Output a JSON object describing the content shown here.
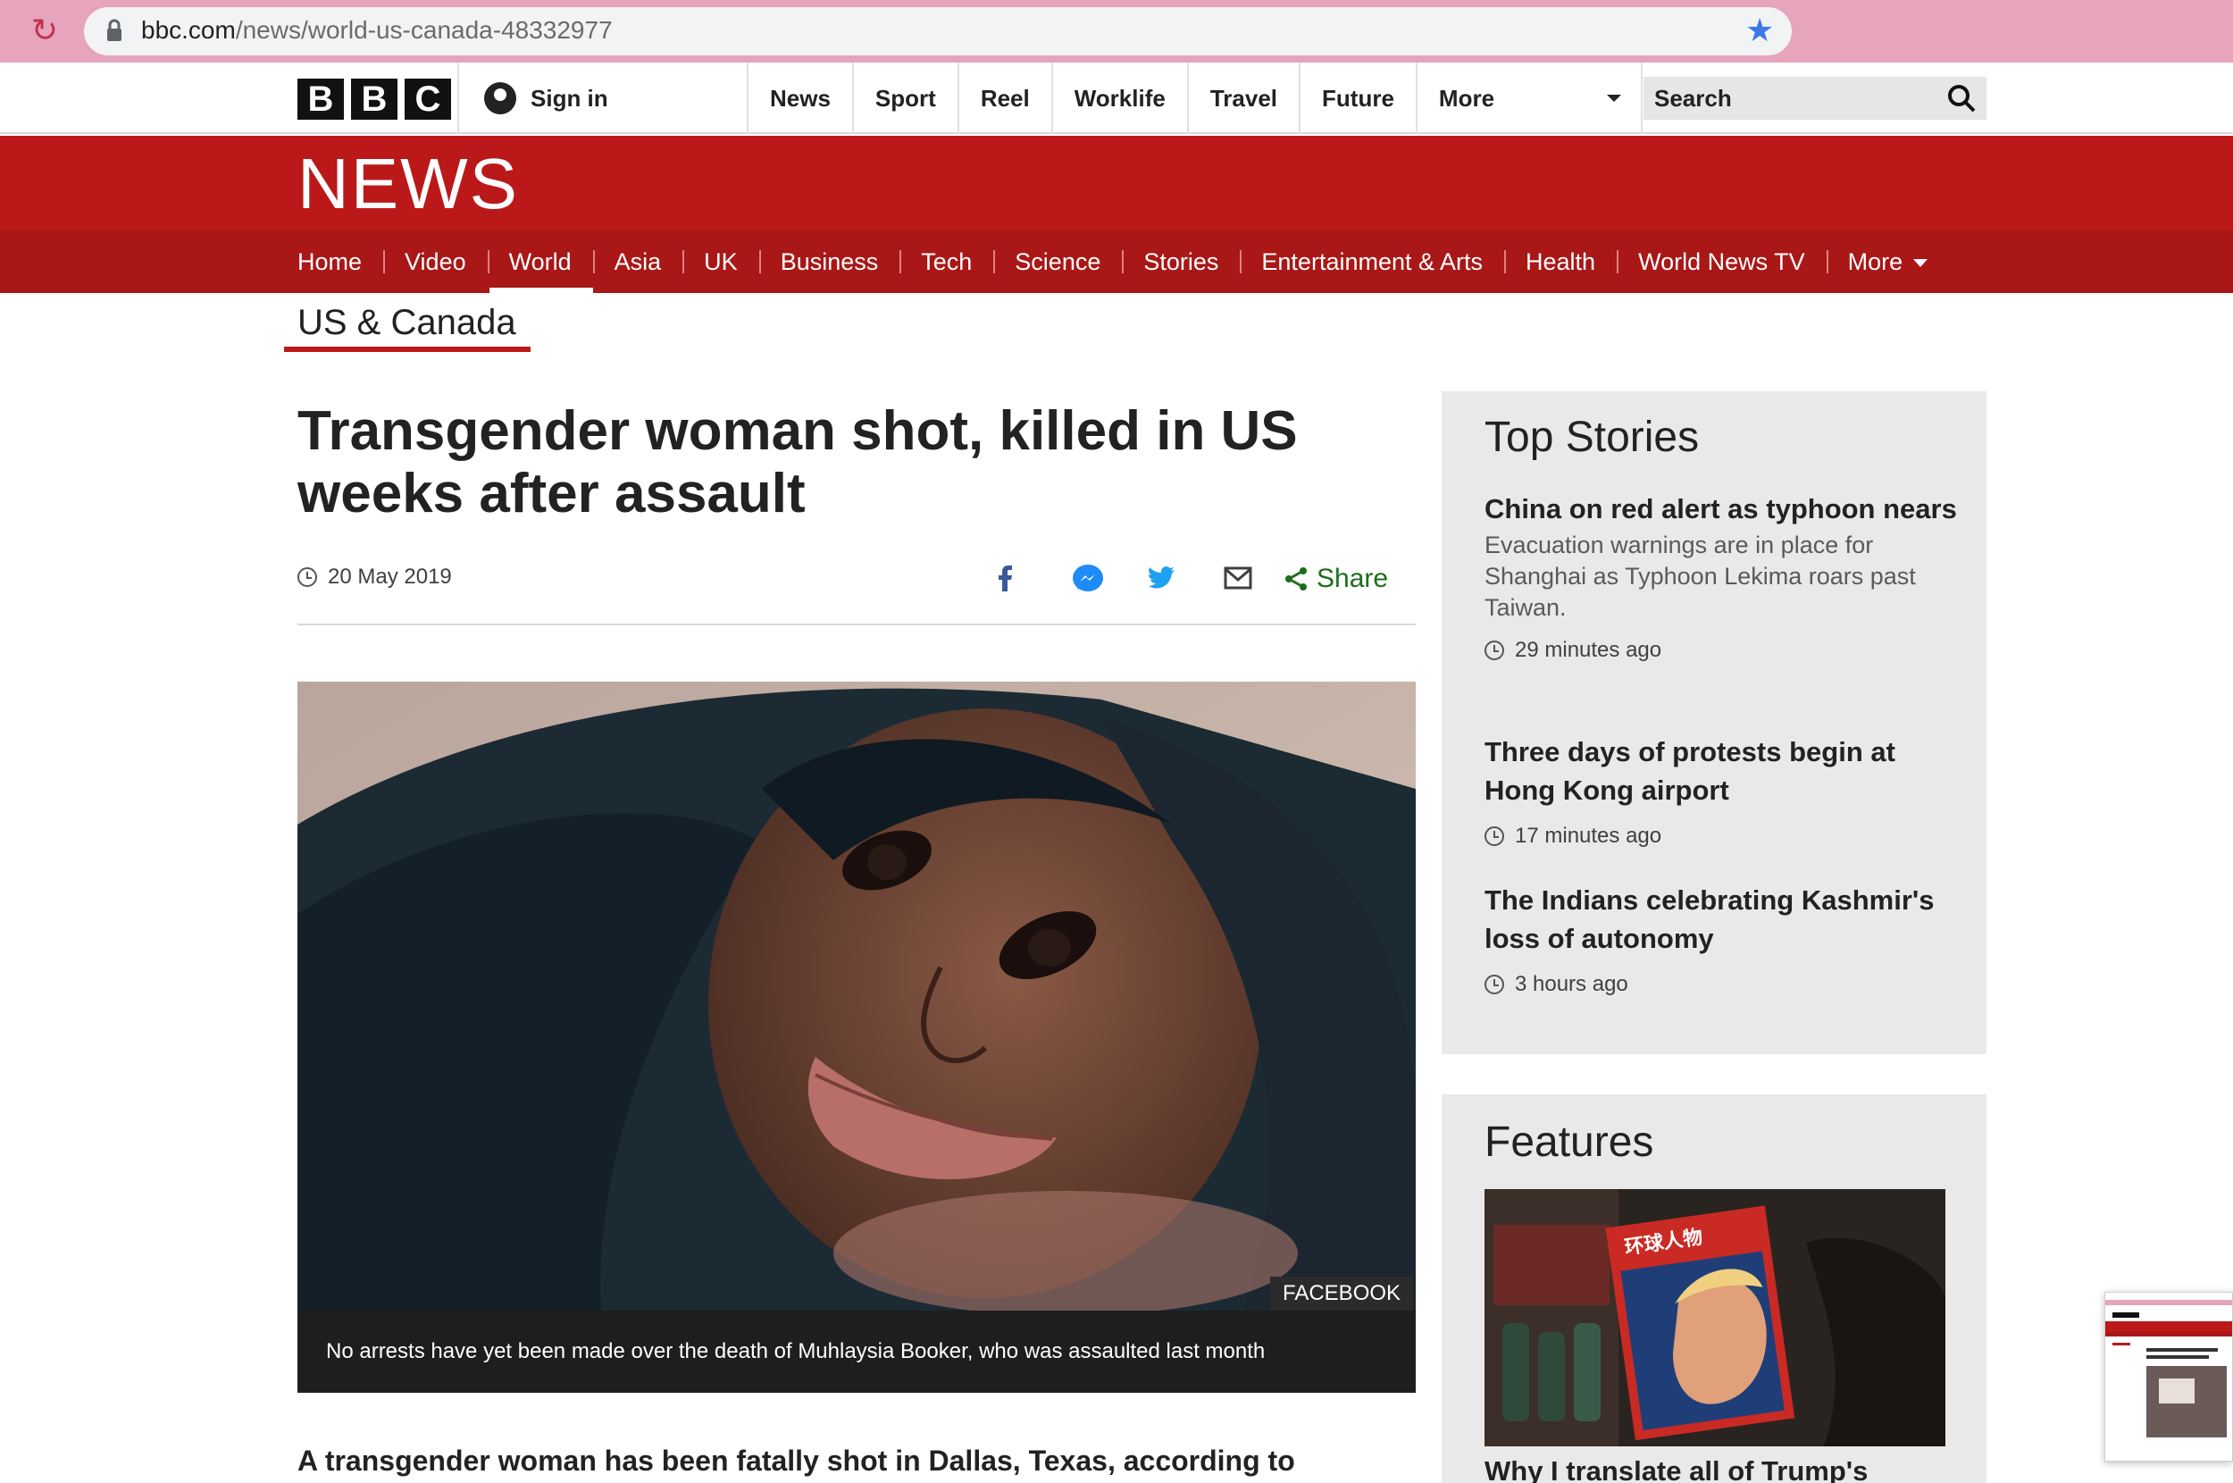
{
  "browser": {
    "url_domain": "bbc.com",
    "url_path": "/news/world-us-canada-48332977"
  },
  "masthead": {
    "logo_letters": [
      "B",
      "B",
      "C"
    ],
    "signin_label": "Sign in",
    "nav": [
      "News",
      "Sport",
      "Reel",
      "Worklife",
      "Travel",
      "Future",
      "More"
    ],
    "search_placeholder": "Search"
  },
  "news": {
    "title": "NEWS",
    "tabs": [
      "Home",
      "Video",
      "World",
      "Asia",
      "UK",
      "Business",
      "Tech",
      "Science",
      "Stories",
      "Entertainment & Arts",
      "Health",
      "World News TV",
      "More"
    ],
    "active_tab": "World",
    "section": "US & Canada"
  },
  "article": {
    "headline": "Transgender woman shot, killed in US weeks after assault",
    "date": "20 May 2019",
    "share_label": "Share",
    "share_icons": [
      "facebook-icon",
      "messenger-icon",
      "twitter-icon",
      "email-icon",
      "share-icon"
    ],
    "image_credit": "FACEBOOK",
    "caption": "No arrests have yet been made over the death of Muhlaysia Booker, who was assaulted last month",
    "lede": "A transgender woman has been fatally shot in Dallas, Texas, according to"
  },
  "sidebar": {
    "top_stories_title": "Top Stories",
    "stories": [
      {
        "headline": "China on red alert as typhoon nears",
        "summary": "Evacuation warnings are in place for Shanghai as Typhoon Lekima roars past Taiwan.",
        "time": "29 minutes ago"
      },
      {
        "headline": "Three days of protests begin at Hong Kong airport",
        "summary": "",
        "time": "17 minutes ago"
      },
      {
        "headline": "The Indians celebrating Kashmir's loss of autonomy",
        "summary": "",
        "time": "3 hours ago"
      }
    ],
    "features_title": "Features",
    "feature_headline": "Why I translate all of Trump's",
    "feature_magazine_text": "环球人物"
  },
  "colors": {
    "bbc_red": "#bb1919",
    "nav_red": "#a91717",
    "share_green": "#1b6f1b",
    "browser_bar": "#e7a4bd"
  }
}
